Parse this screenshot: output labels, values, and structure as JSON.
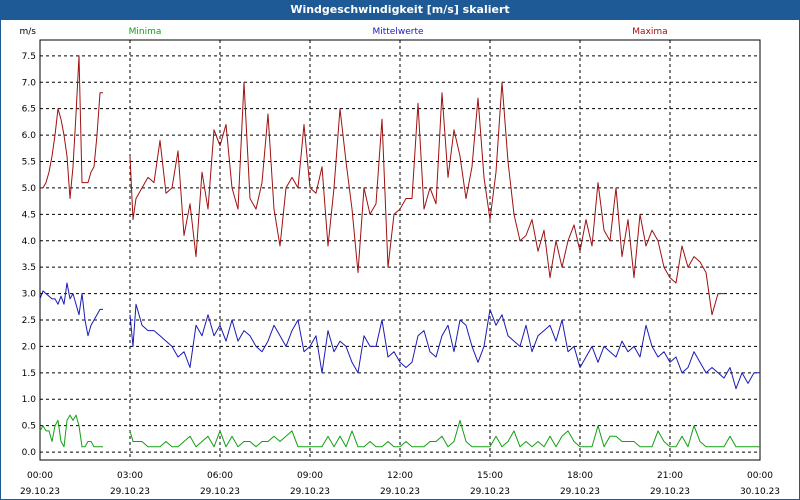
{
  "title": "Windgeschwindigkeit [m/s] skaliert",
  "colors": {
    "titlebar": "#1e5a96",
    "minima": "#12a012",
    "mittel": "#1a1ab8",
    "maxima": "#a01010"
  },
  "chart_data": {
    "type": "line",
    "title": "Windgeschwindigkeit [m/s] skaliert",
    "ylabel": "m/s",
    "ylim": [
      -0.15,
      7.8
    ],
    "yticks": [
      0.0,
      0.5,
      1.0,
      1.5,
      2.0,
      2.5,
      3.0,
      3.5,
      4.0,
      4.5,
      5.0,
      5.5,
      6.0,
      6.5,
      7.0,
      7.5
    ],
    "ytick_labels": [
      "0.0",
      "0.5",
      "1.0",
      "1.5",
      "2.0",
      "2.5",
      "3.0",
      "3.5",
      "4.0",
      "4.5",
      "5.0",
      "5.5",
      "6.0",
      "6.5",
      "7.0",
      "7.5"
    ],
    "xlim_hours": [
      0,
      24
    ],
    "xticks": [
      {
        "time": "00:00",
        "date": "29.10.23"
      },
      {
        "time": "03:00",
        "date": "29.10.23"
      },
      {
        "time": "06:00",
        "date": "29.10.23"
      },
      {
        "time": "09:00",
        "date": "29.10.23"
      },
      {
        "time": "12:00",
        "date": "29.10.23"
      },
      {
        "time": "15:00",
        "date": "29.10.23"
      },
      {
        "time": "18:00",
        "date": "29.10.23"
      },
      {
        "time": "21:00",
        "date": "29.10.23"
      },
      {
        "time": "00:00",
        "date": "30.10.23"
      }
    ],
    "grid": true,
    "series": [
      {
        "name": "Minima",
        "segments": [
          {
            "x_hours": [
              0.0,
              0.1,
              0.2,
              0.3,
              0.4,
              0.5,
              0.6,
              0.7,
              0.8,
              0.9,
              1.0,
              1.1,
              1.2,
              1.3,
              1.4,
              1.5,
              1.6,
              1.7,
              1.8,
              1.9,
              2.0,
              2.1
            ],
            "values": [
              0.4,
              0.5,
              0.4,
              0.4,
              0.2,
              0.5,
              0.6,
              0.2,
              0.1,
              0.6,
              0.7,
              0.6,
              0.7,
              0.5,
              0.1,
              0.1,
              0.2,
              0.2,
              0.1,
              0.1,
              0.1,
              0.1
            ]
          },
          {
            "x_hours": [
              3.0,
              3.1,
              3.2,
              3.4,
              3.6,
              3.8,
              4.0,
              4.2,
              4.4,
              4.6,
              4.8,
              5.0,
              5.2,
              5.4,
              5.6,
              5.8,
              6.0,
              6.2,
              6.4,
              6.6,
              6.8,
              7.0,
              7.2,
              7.4,
              7.6,
              7.8,
              8.0,
              8.2,
              8.4,
              8.6,
              8.8,
              9.0,
              9.2,
              9.4,
              9.6,
              9.8,
              10.0,
              10.2,
              10.4,
              10.6,
              10.8,
              11.0,
              11.2,
              11.4,
              11.6,
              11.8,
              12.0,
              12.2,
              12.4,
              12.6,
              12.8,
              13.0,
              13.2,
              13.4,
              13.6,
              13.8,
              14.0,
              14.2,
              14.4,
              14.6,
              14.8,
              15.0,
              15.2,
              15.4,
              15.6,
              15.8,
              16.0,
              16.2,
              16.4,
              16.6,
              16.8,
              17.0,
              17.2,
              17.4,
              17.6,
              17.8,
              18.0,
              18.2,
              18.4,
              18.6,
              18.8,
              19.0,
              19.2,
              19.4,
              19.6,
              19.8,
              20.0,
              20.2,
              20.4,
              20.6,
              20.8,
              21.0,
              21.2,
              21.4,
              21.6,
              21.8,
              22.0,
              22.2,
              22.4,
              22.6,
              22.8,
              23.0,
              23.2,
              23.4,
              23.6,
              23.8,
              24.0
            ],
            "values": [
              0.4,
              0.2,
              0.2,
              0.2,
              0.1,
              0.1,
              0.1,
              0.2,
              0.1,
              0.1,
              0.2,
              0.3,
              0.1,
              0.2,
              0.3,
              0.1,
              0.4,
              0.1,
              0.3,
              0.1,
              0.2,
              0.2,
              0.1,
              0.2,
              0.2,
              0.3,
              0.2,
              0.3,
              0.4,
              0.1,
              0.1,
              0.1,
              0.1,
              0.1,
              0.3,
              0.1,
              0.3,
              0.1,
              0.4,
              0.1,
              0.1,
              0.2,
              0.1,
              0.1,
              0.2,
              0.1,
              0.1,
              0.2,
              0.1,
              0.1,
              0.1,
              0.2,
              0.2,
              0.3,
              0.1,
              0.2,
              0.6,
              0.2,
              0.1,
              0.1,
              0.1,
              0.1,
              0.3,
              0.1,
              0.2,
              0.4,
              0.1,
              0.2,
              0.1,
              0.2,
              0.1,
              0.3,
              0.1,
              0.3,
              0.4,
              0.2,
              0.1,
              0.1,
              0.1,
              0.5,
              0.1,
              0.3,
              0.3,
              0.2,
              0.2,
              0.2,
              0.1,
              0.1,
              0.1,
              0.4,
              0.2,
              0.1,
              0.1,
              0.3,
              0.1,
              0.5,
              0.2,
              0.1,
              0.1,
              0.1,
              0.1,
              0.3,
              0.1,
              0.1,
              0.1,
              0.1,
              0.1
            ]
          }
        ]
      },
      {
        "name": "Mittelwerte",
        "segments": [
          {
            "x_hours": [
              0.0,
              0.1,
              0.2,
              0.3,
              0.4,
              0.5,
              0.6,
              0.7,
              0.8,
              0.9,
              1.0,
              1.1,
              1.2,
              1.3,
              1.4,
              1.5,
              1.6,
              1.7,
              1.8,
              1.9,
              2.0,
              2.1
            ],
            "values": [
              2.9,
              3.05,
              3.0,
              2.95,
              2.9,
              2.9,
              2.8,
              2.95,
              2.8,
              3.2,
              2.9,
              3.0,
              2.8,
              2.6,
              3.0,
              2.5,
              2.2,
              2.4,
              2.5,
              2.6,
              2.7,
              2.7
            ]
          },
          {
            "x_hours": [
              3.0,
              3.1,
              3.2,
              3.4,
              3.6,
              3.8,
              4.0,
              4.2,
              4.4,
              4.6,
              4.8,
              5.0,
              5.2,
              5.4,
              5.6,
              5.8,
              6.0,
              6.2,
              6.4,
              6.6,
              6.8,
              7.0,
              7.2,
              7.4,
              7.6,
              7.8,
              8.0,
              8.2,
              8.4,
              8.6,
              8.8,
              9.0,
              9.2,
              9.4,
              9.6,
              9.8,
              10.0,
              10.2,
              10.4,
              10.6,
              10.8,
              11.0,
              11.2,
              11.4,
              11.6,
              11.8,
              12.0,
              12.2,
              12.4,
              12.6,
              12.8,
              13.0,
              13.2,
              13.4,
              13.6,
              13.8,
              14.0,
              14.2,
              14.4,
              14.6,
              14.8,
              15.0,
              15.2,
              15.4,
              15.6,
              15.8,
              16.0,
              16.2,
              16.4,
              16.6,
              16.8,
              17.0,
              17.2,
              17.4,
              17.6,
              17.8,
              18.0,
              18.2,
              18.4,
              18.6,
              18.8,
              19.0,
              19.2,
              19.4,
              19.6,
              19.8,
              20.0,
              20.2,
              20.4,
              20.6,
              20.8,
              21.0,
              21.2,
              21.4,
              21.6,
              21.8,
              22.0,
              22.2,
              22.4,
              22.6,
              22.8,
              23.0,
              23.2,
              23.4,
              23.6,
              23.8,
              24.0
            ],
            "values": [
              2.6,
              2.0,
              2.8,
              2.4,
              2.3,
              2.3,
              2.2,
              2.1,
              2.0,
              1.8,
              1.9,
              1.6,
              2.4,
              2.2,
              2.6,
              2.2,
              2.4,
              2.1,
              2.5,
              2.1,
              2.3,
              2.2,
              2.0,
              1.9,
              2.1,
              2.4,
              2.2,
              2.0,
              2.3,
              2.5,
              1.9,
              2.0,
              2.2,
              1.5,
              2.3,
              1.9,
              2.1,
              2.0,
              1.7,
              1.5,
              2.2,
              2.0,
              2.0,
              2.5,
              1.8,
              1.9,
              1.7,
              1.6,
              1.7,
              2.2,
              2.3,
              1.9,
              1.8,
              2.2,
              2.4,
              1.9,
              2.5,
              2.4,
              2.0,
              1.7,
              2.0,
              2.7,
              2.4,
              2.6,
              2.2,
              2.1,
              2.0,
              2.4,
              1.9,
              2.2,
              2.3,
              2.4,
              2.1,
              2.5,
              1.9,
              2.0,
              1.6,
              1.8,
              2.0,
              1.7,
              2.0,
              1.9,
              1.8,
              2.1,
              1.9,
              2.0,
              1.8,
              2.4,
              2.0,
              1.8,
              1.9,
              1.7,
              1.8,
              1.5,
              1.6,
              1.9,
              1.7,
              1.5,
              1.6,
              1.5,
              1.4,
              1.6,
              1.2,
              1.5,
              1.3,
              1.5,
              1.5
            ]
          }
        ]
      },
      {
        "name": "Maxima",
        "segments": [
          {
            "x_hours": [
              0.0,
              0.1,
              0.2,
              0.3,
              0.4,
              0.5,
              0.6,
              0.7,
              0.8,
              0.9,
              1.0,
              1.1,
              1.2,
              1.3,
              1.4,
              1.5,
              1.6,
              1.7,
              1.8,
              1.9,
              2.0,
              2.1
            ],
            "values": [
              5.0,
              5.0,
              5.1,
              5.3,
              5.6,
              6.0,
              6.5,
              6.3,
              6.0,
              5.6,
              4.8,
              5.4,
              6.4,
              7.5,
              5.1,
              5.1,
              5.1,
              5.3,
              5.4,
              6.0,
              6.8,
              6.8
            ]
          },
          {
            "x_hours": [
              3.0,
              3.1,
              3.2,
              3.4,
              3.6,
              3.8,
              4.0,
              4.2,
              4.4,
              4.6,
              4.8,
              5.0,
              5.2,
              5.4,
              5.6,
              5.8,
              6.0,
              6.2,
              6.4,
              6.6,
              6.8,
              7.0,
              7.2,
              7.4,
              7.6,
              7.8,
              8.0,
              8.2,
              8.4,
              8.6,
              8.8,
              9.0,
              9.2,
              9.4,
              9.6,
              9.8,
              10.0,
              10.2,
              10.4,
              10.6,
              10.8,
              11.0,
              11.2,
              11.4,
              11.6,
              11.8,
              12.0,
              12.2,
              12.4,
              12.6,
              12.8,
              13.0,
              13.2,
              13.4,
              13.6,
              13.8,
              14.0,
              14.2,
              14.4,
              14.6,
              14.8,
              15.0,
              15.2,
              15.4,
              15.6,
              15.8,
              16.0,
              16.2,
              16.4,
              16.6,
              16.8,
              17.0,
              17.2,
              17.4,
              17.6,
              17.8,
              18.0,
              18.2,
              18.4,
              18.6,
              18.8,
              19.0,
              19.2,
              19.4,
              19.6,
              19.8,
              20.0,
              20.2,
              20.4,
              20.6,
              20.8,
              21.0,
              21.2,
              21.4,
              21.6,
              21.8,
              22.0,
              22.2,
              22.4,
              22.6,
              22.8,
              23.0,
              23.2,
              23.4,
              23.6,
              23.8,
              24.0
            ],
            "values": [
              5.6,
              4.4,
              4.8,
              5.0,
              5.2,
              5.1,
              5.9,
              4.9,
              5.0,
              5.7,
              4.1,
              4.7,
              3.7,
              5.3,
              4.6,
              6.1,
              5.8,
              6.2,
              5.0,
              4.6,
              7.0,
              4.8,
              4.6,
              5.1,
              6.4,
              4.6,
              3.9,
              5.0,
              5.2,
              5.0,
              6.2,
              5.0,
              4.9,
              5.4,
              3.9,
              5.0,
              6.5,
              5.5,
              4.6,
              3.4,
              5.0,
              4.5,
              4.7,
              6.3,
              3.5,
              4.5,
              4.6,
              4.8,
              4.8,
              6.6,
              4.6,
              5.0,
              4.7,
              6.8,
              5.2,
              6.1,
              5.6,
              4.8,
              5.4,
              6.7,
              5.2,
              4.4,
              5.3,
              7.0,
              5.5,
              4.5,
              4.0,
              4.1,
              4.4,
              3.8,
              4.2,
              3.3,
              4.0,
              3.5,
              4.0,
              4.3,
              3.8,
              4.4,
              3.9,
              5.1,
              4.2,
              4.0,
              5.0,
              3.7,
              4.4,
              3.3,
              4.5,
              3.9,
              4.2,
              4.0,
              3.5,
              3.3,
              3.2,
              3.9,
              3.5,
              3.7,
              3.6,
              3.4,
              2.6,
              3.0,
              3.0
            ]
          }
        ]
      }
    ]
  }
}
